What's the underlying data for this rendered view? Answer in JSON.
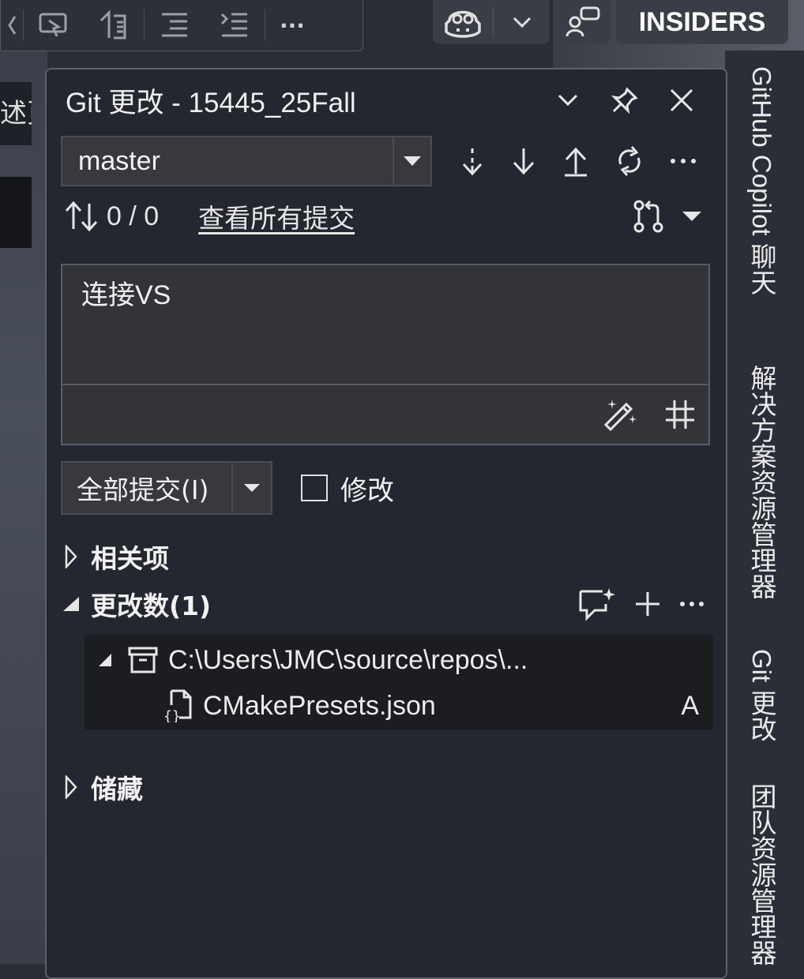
{
  "background": {
    "left_tab_fragment": "述页"
  },
  "toolbar": {
    "more_label": "···"
  },
  "topright": {
    "insiders_label": "INSIDERS"
  },
  "side_tabs": [
    {
      "label": "GitHub Copilot 聊天"
    },
    {
      "label": "解决方案资源管理器"
    },
    {
      "label": "Git 更改"
    },
    {
      "label": "团队资源管理器"
    }
  ],
  "panel": {
    "title": "Git 更改 - 15445_25Fall",
    "branch": "master",
    "sync_counts": "0 / 0",
    "view_all_commits": "查看所有提交",
    "commit_message": "连接VS",
    "commit_all_label": "全部提交(I)",
    "amend_label": "修改",
    "sections": {
      "related": "相关项",
      "changes": "更改数(1)",
      "stashes": "储藏"
    },
    "tree": {
      "repo_path": "C:\\Users\\JMC\\source\\repos\\...",
      "file_name": "CMakePresets.json",
      "file_status": "A"
    }
  },
  "colors": {
    "panel_bg": "#24272f",
    "panel_border": "#5d6068",
    "text": "#e6e6e6",
    "tree_bg": "#1c1d21"
  }
}
